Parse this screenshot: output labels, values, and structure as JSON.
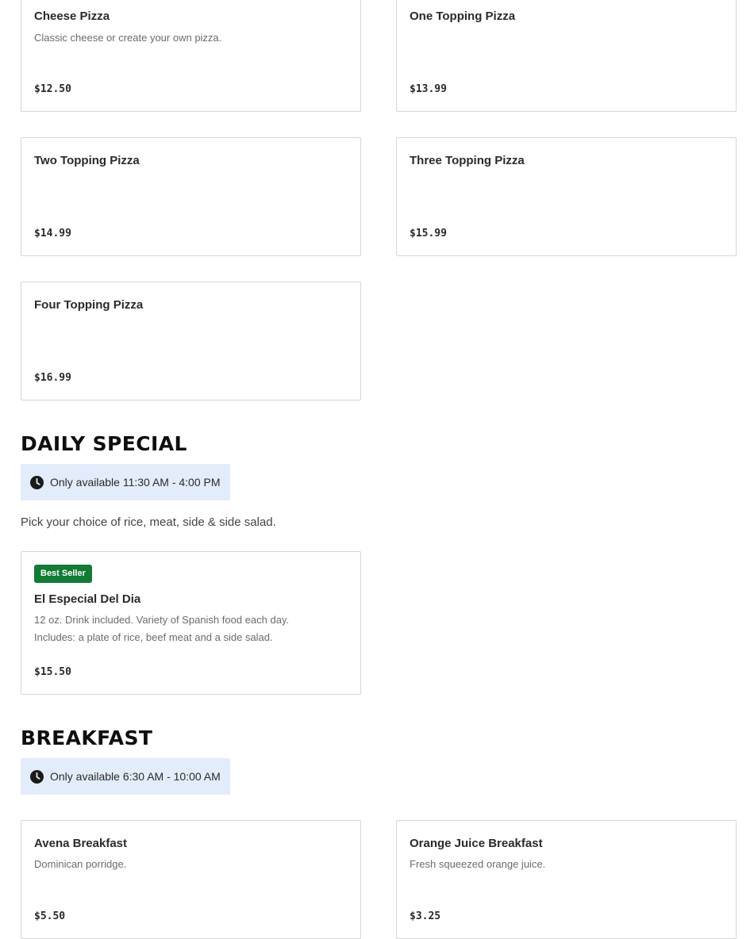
{
  "pizza": {
    "items": [
      {
        "name": "Cheese Pizza",
        "description": "Classic cheese or create your own pizza.",
        "price": "$12.50"
      },
      {
        "name": "One Topping Pizza",
        "description": "",
        "price": "$13.99"
      },
      {
        "name": "Two Topping Pizza",
        "description": "",
        "price": "$14.99"
      },
      {
        "name": "Three Topping Pizza",
        "description": "",
        "price": "$15.99"
      },
      {
        "name": "Four Topping Pizza",
        "description": "",
        "price": "$16.99"
      }
    ]
  },
  "daily_special": {
    "title": "DAILY SPECIAL",
    "hours": "Only available 11:30 AM - 4:00 PM",
    "description": "Pick your choice of rice, meat, side & side salad.",
    "items": [
      {
        "badge": "Best Seller",
        "name": "El Especial Del Dia",
        "description": "12 oz. Drink included. Variety of Spanish food each day. Includes: a plate of rice, beef meat and a side salad.",
        "price": "$15.50"
      }
    ]
  },
  "breakfast": {
    "title": "BREAKFAST",
    "hours": "Only available 6:30 AM - 10:00 AM",
    "items": [
      {
        "name": "Avena Breakfast",
        "description": "Dominican porridge.",
        "price": "$5.50"
      },
      {
        "name": "Orange Juice Breakfast",
        "description": "Fresh squeezed orange juice.",
        "price": "$3.25"
      }
    ]
  },
  "colors": {
    "badge_bg": "#127b35",
    "hours_bg": "#e3ecfa",
    "card_border": "#d6d6d6"
  },
  "icons": {
    "hours": "clock-icon"
  }
}
